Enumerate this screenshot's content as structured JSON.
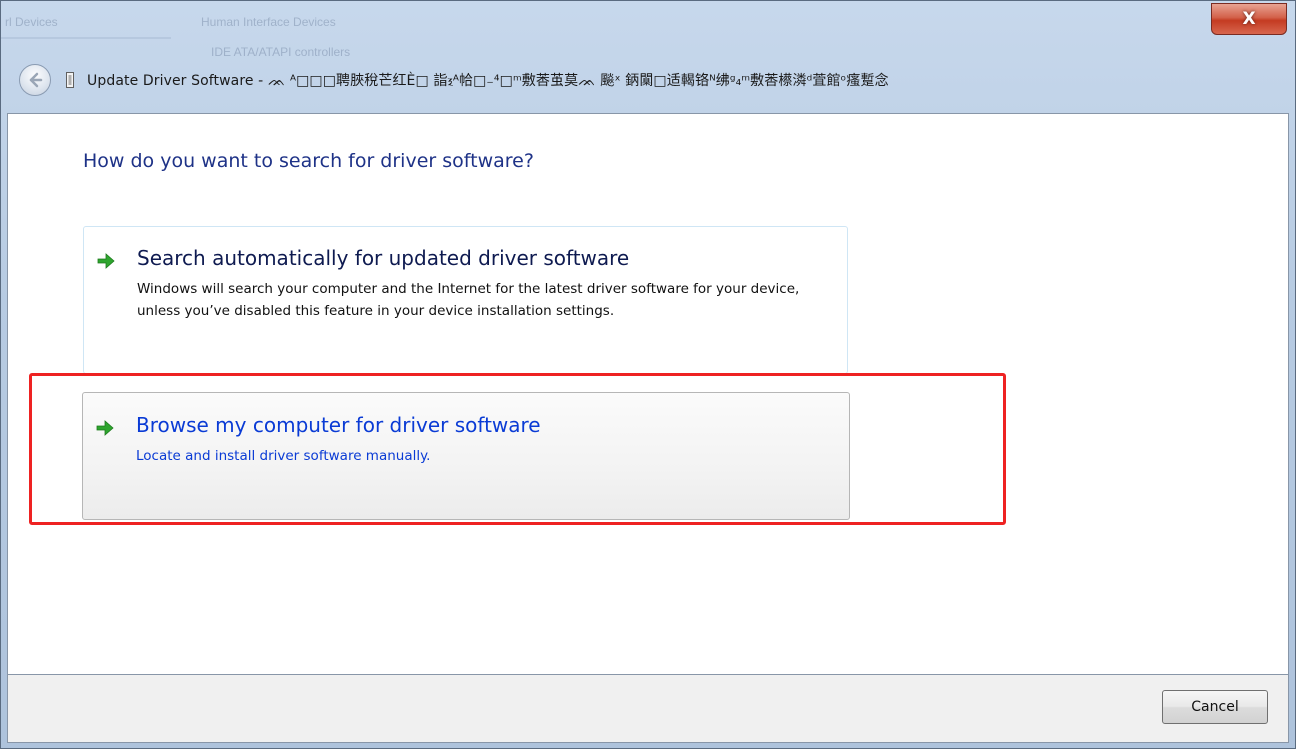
{
  "window": {
    "title": "Update Driver Software - ᨏ      ᴬ□□□聘脥稅芒红È□  詣ⲝᴬ帢□₋⁴□ᵐ敷莕茧莫ᨏ  飈ˣ  鈵闑□适輵铬ᴺ绋ᵍ₄ᵐ敷莕櫒潾ᵈ萓館ᵒ瘙蹔念",
    "close_label": "X"
  },
  "glass_ghost": {
    "line1": "Human Interface Devices",
    "line2": "IDE ATA/ATAPI controllers"
  },
  "heading": "How do you want to search for driver software?",
  "options": [
    {
      "title": "Search automatically for updated driver software",
      "description": "Windows will search your computer and the Internet for the latest driver software for your device, unless you’ve disabled this feature in your device installation settings."
    },
    {
      "title": "Browse my computer for driver software",
      "description": "Locate and install driver software manually."
    }
  ],
  "footer": {
    "cancel_label": "Cancel"
  },
  "colors": {
    "heading": "#1e3287",
    "link_blue": "#0a3bd5",
    "highlight_red": "#ee2222",
    "arrow_green": "#2ea52e"
  }
}
